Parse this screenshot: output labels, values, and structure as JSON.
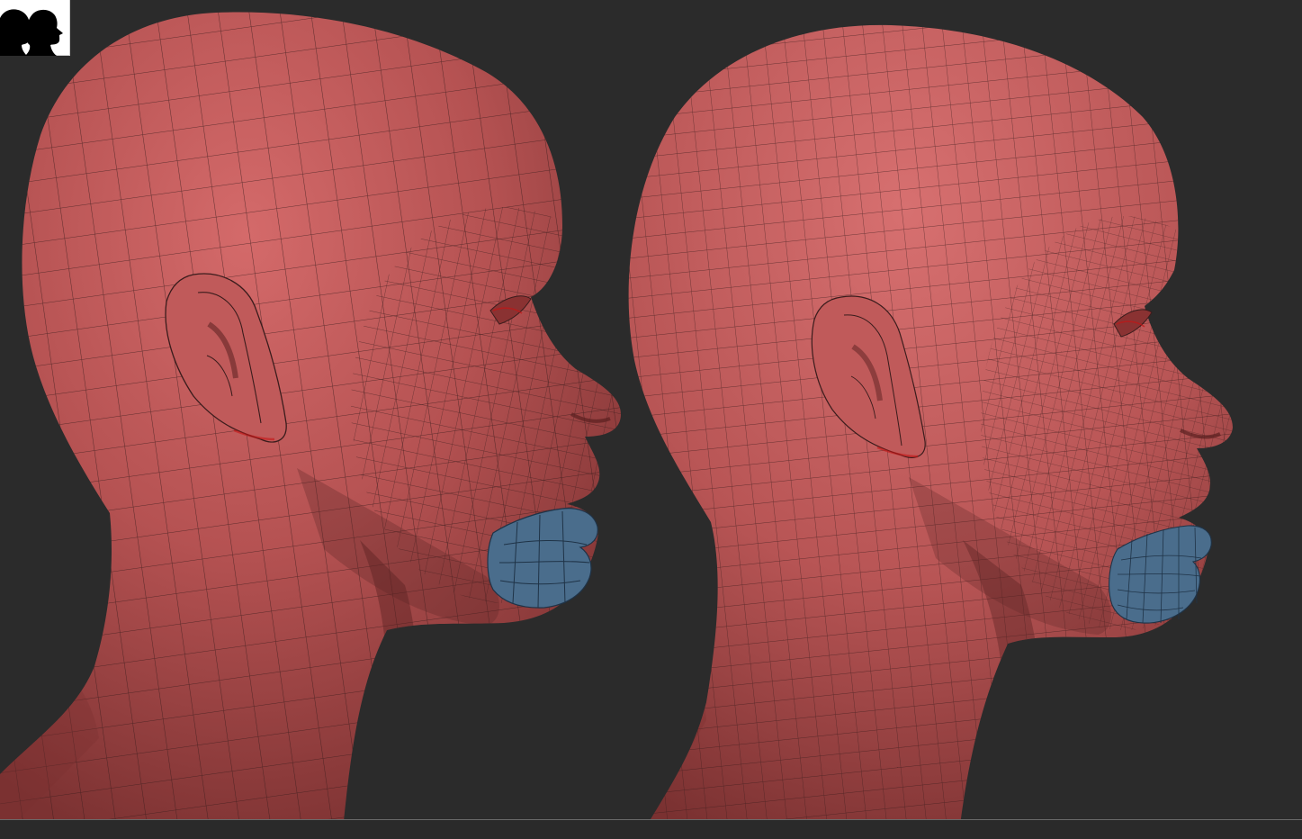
{
  "viewport": {
    "background": "#2b2b2b",
    "material_color": "#b85555",
    "mask_color": "#4a6d8c",
    "wire_color": "#3a1c1c"
  },
  "thumbnail": {
    "icon": "silhouette-heads-icon"
  },
  "models": [
    {
      "id": "lowpoly",
      "label": "",
      "icon": "head-model-lowres"
    },
    {
      "id": "subdivided",
      "label": "",
      "icon": "head-model-highres"
    }
  ]
}
